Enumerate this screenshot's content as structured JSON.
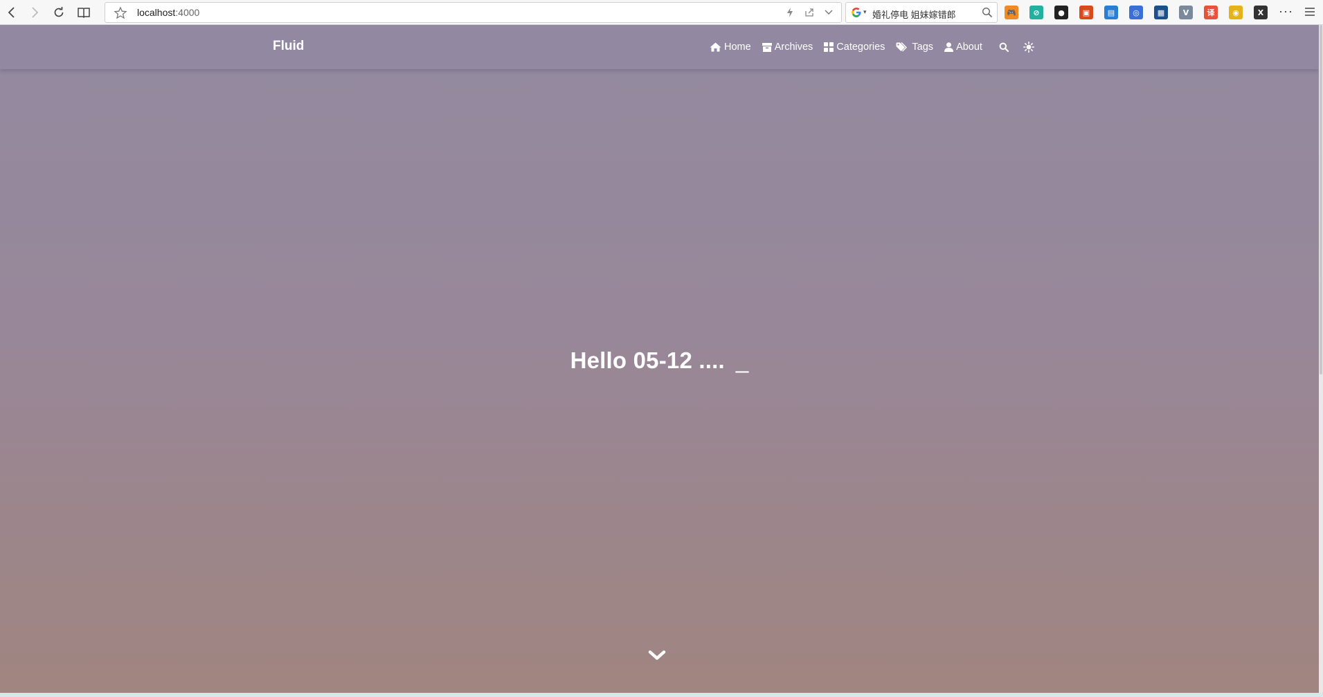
{
  "browser": {
    "url_host": "localhost",
    "url_port": ":4000",
    "search_text": "婚礼停电 姐妹嫁错郎",
    "extensions": [
      {
        "name": "game-extension-icon",
        "color": "#f08a24",
        "glyph": "🎮"
      },
      {
        "name": "green-extension-icon",
        "color": "#22b0a0",
        "glyph": "⊘"
      },
      {
        "name": "black-extension-icon",
        "color": "#222222",
        "glyph": "●"
      },
      {
        "name": "orange-extension-icon",
        "color": "#d84a1b",
        "glyph": "▣"
      },
      {
        "name": "blue-doc-extension-icon",
        "color": "#2a7fd4",
        "glyph": "▤"
      },
      {
        "name": "compass-extension-icon",
        "color": "#3a6fd8",
        "glyph": "◎"
      },
      {
        "name": "navy-extension-icon",
        "color": "#1d4f8a",
        "glyph": "▦"
      },
      {
        "name": "vue-extension-icon",
        "color": "#7a8a9a",
        "glyph": "V"
      },
      {
        "name": "translate-extension-icon",
        "color": "#e5533a",
        "glyph": "译"
      },
      {
        "name": "yellow-extension-icon",
        "color": "#e5b21a",
        "glyph": "◉"
      },
      {
        "name": "x-extension-icon",
        "color": "#333333",
        "glyph": "X"
      }
    ],
    "more_label": "···"
  },
  "site": {
    "brand": "Fluid",
    "nav": [
      {
        "label": "Home",
        "icon": "home-icon"
      },
      {
        "label": "Archives",
        "icon": "archive-icon"
      },
      {
        "label": "Categories",
        "icon": "categories-icon"
      },
      {
        "label": "Tags",
        "icon": "tags-icon"
      },
      {
        "label": "About",
        "icon": "user-icon"
      }
    ]
  },
  "hero": {
    "title": "Hello 05-12 ....",
    "cursor": "_"
  },
  "colors": {
    "hero_top": "#938aa0",
    "hero_bottom": "#a08580",
    "text": "#ffffff"
  }
}
